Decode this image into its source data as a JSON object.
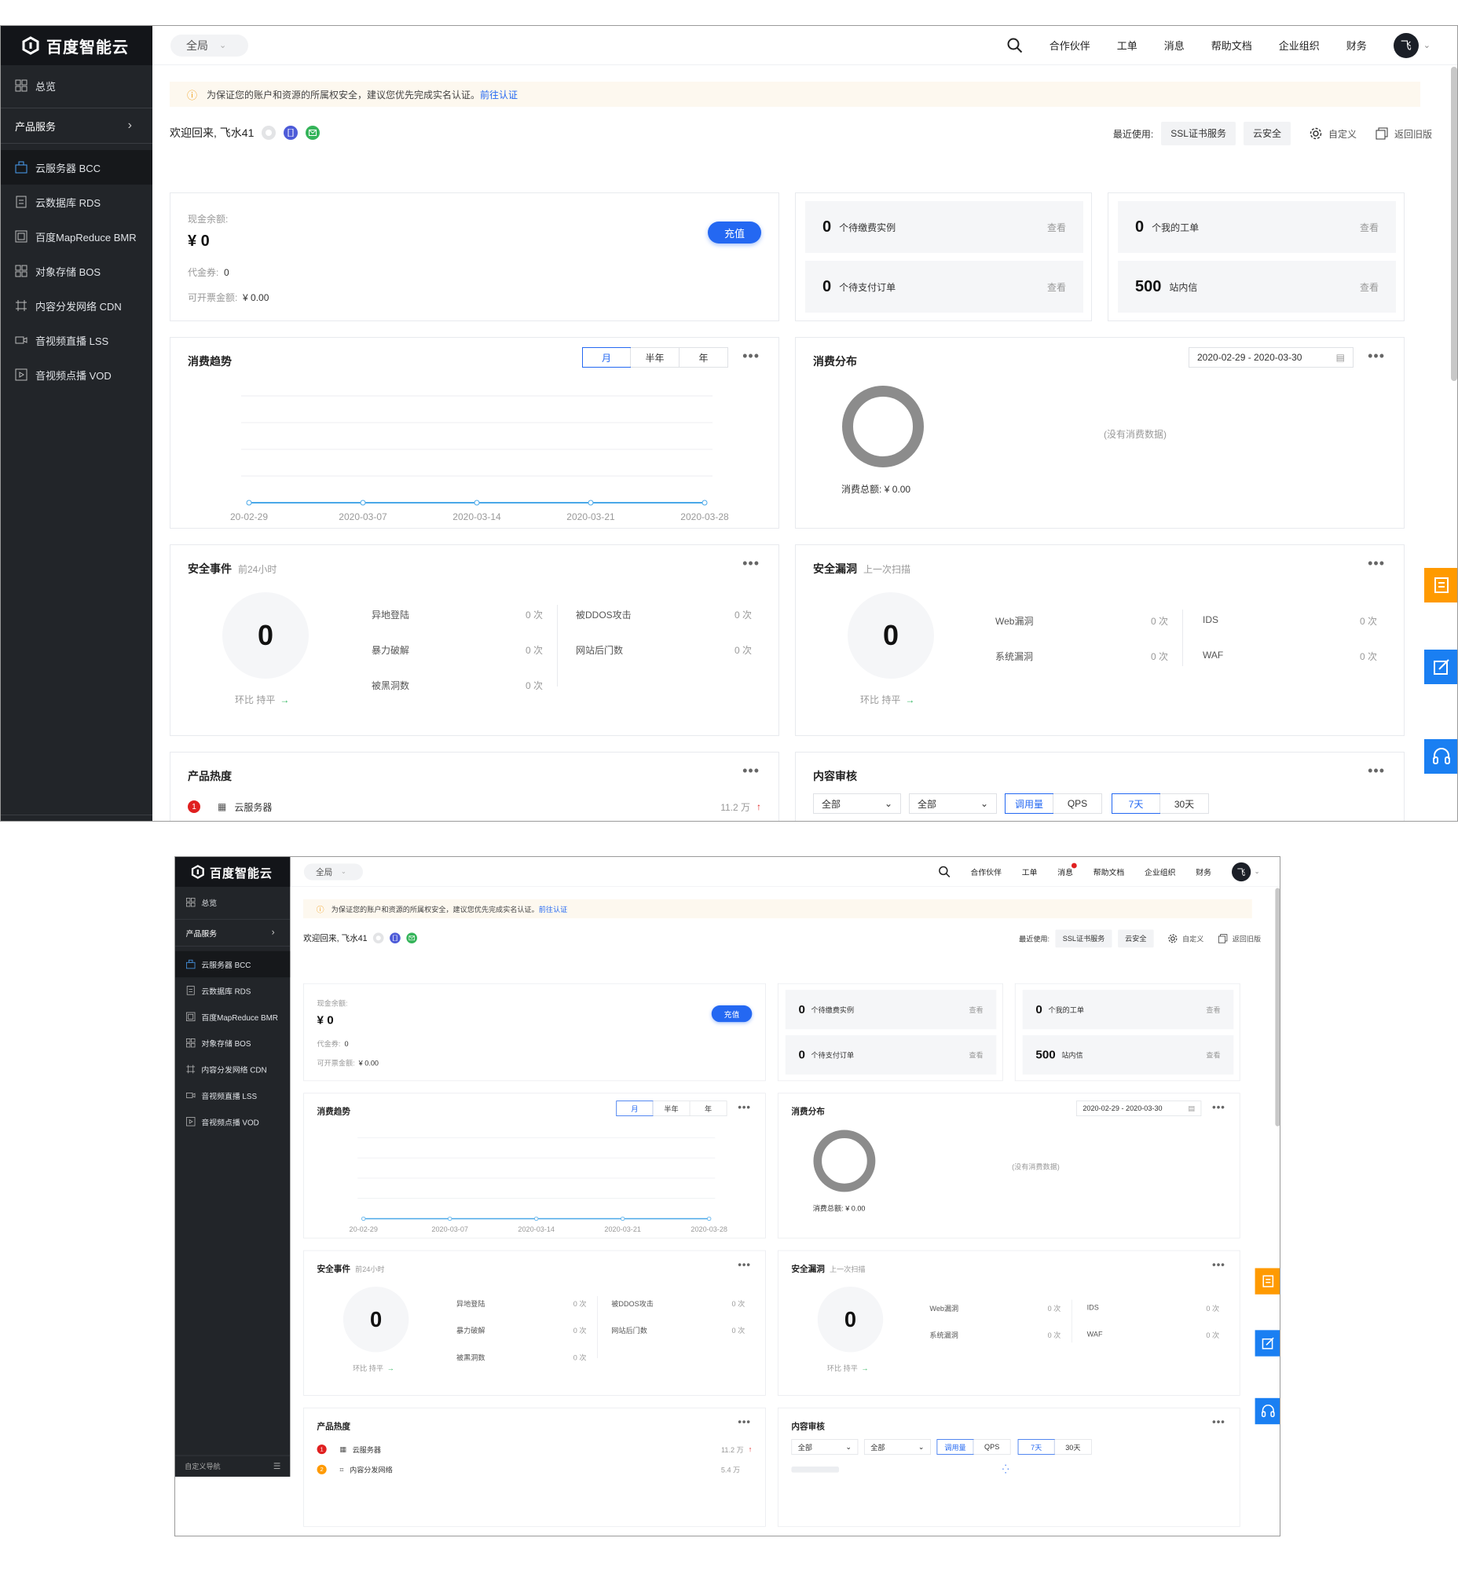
{
  "logo": {
    "text": "百度智能云"
  },
  "header": {
    "scope": "全局",
    "links": {
      "partners": "合作伙伴",
      "tickets": "工单",
      "messages": "消息",
      "docs": "帮助文档",
      "org": "企业组织",
      "finance": "财务"
    },
    "avatar_char": "飞"
  },
  "sidebar": {
    "overview": "总览",
    "products_group": "产品服务",
    "items": {
      "bcc": "云服务器 BCC",
      "rds": "云数据库 RDS",
      "bmr": "百度MapReduce BMR",
      "bos": "对象存储 BOS",
      "cdn": "内容分发网络 CDN",
      "lss": "音视频直播 LSS",
      "vod": "音视频点播 VOD"
    },
    "bottom": "自定义导航"
  },
  "notice": {
    "text": "为保证您的账户和资源的所属权安全，建议您优先完成实名认证。",
    "link": "前往认证"
  },
  "welcome": {
    "text": "欢迎回来, 飞水41"
  },
  "recent": {
    "label": "最近使用:",
    "tags": {
      "ssl": "SSL证书服务",
      "sec": "云安全"
    },
    "customize": "自定义",
    "old": "返回旧版"
  },
  "balance": {
    "cash_label": "现金余额:",
    "cash_value": "¥ 0",
    "voucher_label": "代金券:",
    "voucher_value": "0",
    "invoice_label": "可开票金额:",
    "invoice_value": "¥ 0.00",
    "charge_button": "充值"
  },
  "stats": {
    "pending_instances": {
      "num": "0",
      "label": "个待缴费实例",
      "link": "查看"
    },
    "pending_orders": {
      "num": "0",
      "label": "个待支付订单",
      "link": "查看"
    },
    "my_tickets": {
      "num": "0",
      "label": "个我的工单",
      "link": "查看"
    },
    "site_messages": {
      "num": "500",
      "label": "站内信",
      "link": "查看"
    }
  },
  "trend": {
    "title": "消费趋势",
    "tabs": {
      "month": "月",
      "half": "半年",
      "year": "年"
    },
    "x_labels": [
      "20-02-29",
      "2020-03-07",
      "2020-03-14",
      "2020-03-21",
      "2020-03-28"
    ]
  },
  "chart_data": {
    "type": "line",
    "title": "消费趋势",
    "categories": [
      "2020-02-29",
      "2020-03-07",
      "2020-03-14",
      "2020-03-21",
      "2020-03-28"
    ],
    "values": [
      0,
      0,
      0,
      0,
      0
    ],
    "grid": true,
    "color": "#4aa8e8"
  },
  "distribution": {
    "title": "消费分布",
    "date_range": "2020-02-29 - 2020-03-30",
    "empty": "(没有消费数据)",
    "total_label": "消费总额:",
    "total_value": "¥ 0.00"
  },
  "security_events": {
    "title": "安全事件",
    "sub": "前24小时",
    "count": "0",
    "trend_label": "环比 持平",
    "rows": {
      "remote_login": {
        "label": "异地登陆",
        "value": "0 次"
      },
      "brute_force": {
        "label": "暴力破解",
        "value": "0 次"
      },
      "hacked": {
        "label": "被黑洞数",
        "value": "0 次"
      },
      "ddos": {
        "label": "被DDOS攻击",
        "value": "0 次"
      },
      "backdoor": {
        "label": "网站后门数",
        "value": "0 次"
      }
    }
  },
  "vulns": {
    "title": "安全漏洞",
    "sub": "上一次扫描",
    "count": "0",
    "trend_label": "环比 持平",
    "rows": {
      "web": {
        "label": "Web漏洞",
        "value": "0 次"
      },
      "system": {
        "label": "系统漏洞",
        "value": "0 次"
      },
      "ids": {
        "label": "IDS",
        "value": "0 次"
      },
      "waf": {
        "label": "WAF",
        "value": "0 次"
      }
    }
  },
  "popularity": {
    "title": "产品热度",
    "items": [
      {
        "rank": "1",
        "name": "云服务器",
        "value": "11.2 万"
      },
      {
        "rank": "2",
        "name": "内容分发网络",
        "value": "5.4 万"
      }
    ]
  },
  "moderation": {
    "title": "内容审核",
    "select1": "全部",
    "select2": "全部",
    "metric_tabs": {
      "calls": "调用量",
      "qps": "QPS"
    },
    "range_tabs": {
      "d7": "7天",
      "d30": "30天"
    }
  },
  "colors": {
    "accent": "#2468f2",
    "sidebar": "#222529",
    "orange": "#ff9a00",
    "float_blue": "#1a7ff2"
  }
}
